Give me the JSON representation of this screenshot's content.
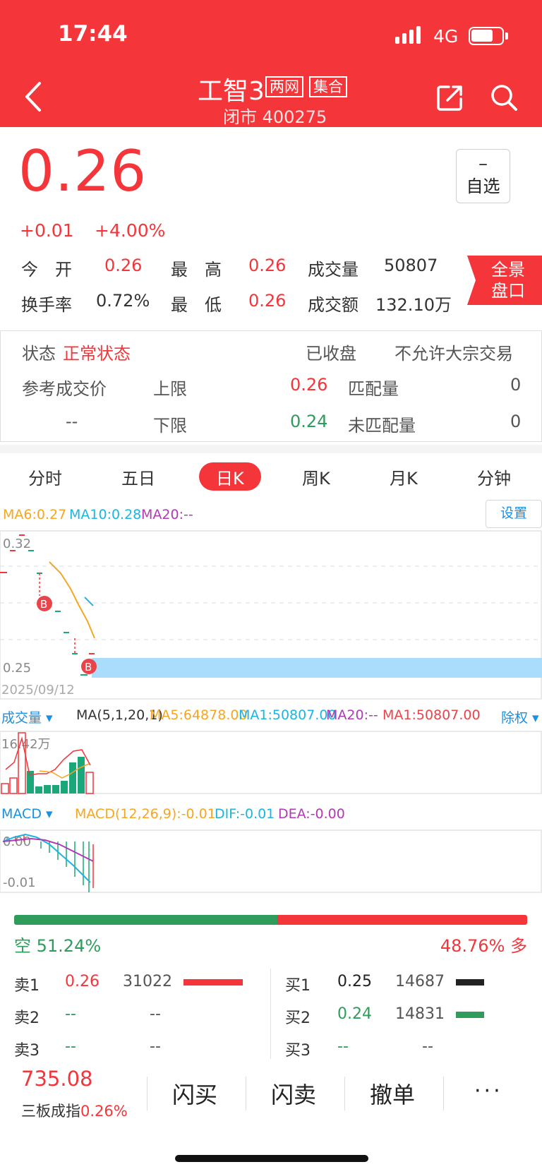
{
  "status_bar": {
    "time": "17:44",
    "network": "4G"
  },
  "header": {
    "title": "工智3",
    "tags": [
      "两网",
      "集合"
    ],
    "subtitle": "闭市 400275"
  },
  "quote": {
    "price": "0.26",
    "change": "+0.01",
    "change_pct": "+4.00%",
    "watchlist_minus": "–",
    "watchlist_label": "自选",
    "rows": [
      {
        "l1": "今　开",
        "v1": "0.26",
        "l2": "最　高",
        "v2": "0.26",
        "l3": "成交量",
        "v3": "50807"
      },
      {
        "l1": "换手率",
        "v1": "0.72%",
        "l2": "最　低",
        "v2": "0.26",
        "l3": "成交额",
        "v3": "132.10万"
      }
    ],
    "panorama_line1": "全景",
    "panorama_line2": "盘口"
  },
  "auction": {
    "state_label": "状态",
    "state_value": "正常状态",
    "closed": "已收盘",
    "block_trade": "不允许大宗交易",
    "ref_price_label": "参考成交价",
    "ref_price_value": "--",
    "upper_label": "上限",
    "upper_value": "0.26",
    "lower_label": "下限",
    "lower_value": "0.24",
    "matched_label": "匹配量",
    "matched_value": "0",
    "unmatched_label": "未匹配量",
    "unmatched_value": "0"
  },
  "tabs": [
    "分时",
    "五日",
    "日K",
    "周K",
    "月K",
    "分钟"
  ],
  "kline": {
    "ma6": "MA6:0.27",
    "ma10": "MA10:0.28",
    "ma20": "MA20:--",
    "settings": "设置",
    "y_high": "0.32",
    "y_low": "0.25",
    "date": "2025/09/12",
    "marker": "B",
    "colors": {
      "up": "#f4353a",
      "down": "#1aa87a",
      "ma6": "#f5a623",
      "ma10": "#1cb5e0",
      "ma20": "#b03ab5"
    }
  },
  "volume": {
    "label": "成交量",
    "ma_params": "MA(5,1,20,1)",
    "ma5": "MA5:64878.00",
    "ma1": "MA1:50807.00",
    "ma20": "MA20:--",
    "ma1b": "MA1:50807.00",
    "exright": "除权",
    "y_max": "16.42万"
  },
  "macd": {
    "label": "MACD",
    "params": "MACD(12,26,9):-0.01",
    "dif": "DIF:-0.01",
    "dea": "DEA:-0.00",
    "y_top": "0.00",
    "y_bottom": "-0.01"
  },
  "long_short": {
    "short_text": "空 51.24%",
    "long_text": "48.76% 多",
    "short_pct": 51.24,
    "long_pct": 48.76
  },
  "orderbook": {
    "sell": [
      {
        "label": "卖1",
        "price": "0.26",
        "volume": "31022"
      },
      {
        "label": "卖2",
        "price": "--",
        "volume": "--"
      },
      {
        "label": "卖3",
        "price": "--",
        "volume": "--"
      }
    ],
    "buy": [
      {
        "label": "买1",
        "price": "0.25",
        "volume": "14687"
      },
      {
        "label": "买2",
        "price": "0.24",
        "volume": "14831"
      },
      {
        "label": "买3",
        "price": "--",
        "volume": "--"
      }
    ]
  },
  "toolbar": {
    "index_value": "735.08",
    "index_name": "三板成指",
    "index_pct": "0.26%",
    "flash_buy": "闪买",
    "flash_sell": "闪卖",
    "cancel": "撤单",
    "more": "···"
  }
}
